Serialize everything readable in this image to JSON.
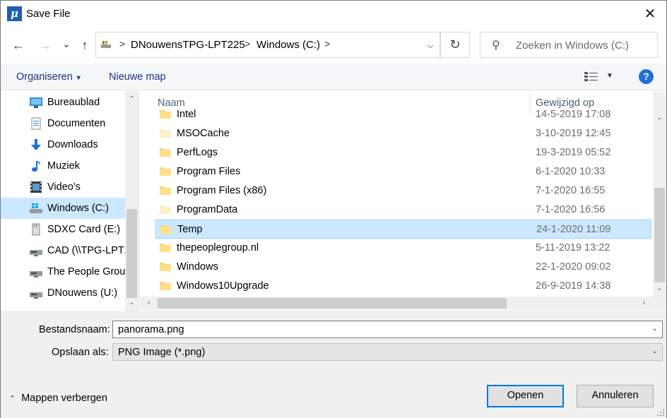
{
  "window": {
    "title": "Save File",
    "app_icon_glyph": "μ",
    "close_glyph": "✕"
  },
  "nav": {
    "back_glyph": "←",
    "forward_glyph": "→",
    "recent_glyph": "⌄",
    "up_glyph": "↑",
    "breadcrumbs": [
      "DNouwensTPG-LPT225",
      "Windows (C:)"
    ],
    "crumb_separator": ">",
    "refresh_glyph": "↻",
    "search_placeholder": "Zoeken in Windows (C:)"
  },
  "toolbar": {
    "organize_label": "Organiseren",
    "new_folder_label": "Nieuwe map",
    "help_glyph": "?"
  },
  "sidebar": {
    "items": [
      {
        "label": "Bureaublad",
        "icon": "desktop-icon",
        "selected": false
      },
      {
        "label": "Documenten",
        "icon": "documents-icon",
        "selected": false
      },
      {
        "label": "Downloads",
        "icon": "downloads-icon",
        "selected": false
      },
      {
        "label": "Muziek",
        "icon": "music-icon",
        "selected": false
      },
      {
        "label": "Video's",
        "icon": "videos-icon",
        "selected": false
      },
      {
        "label": "Windows (C:)",
        "icon": "windows-drive-icon",
        "selected": true
      },
      {
        "label": "SDXC Card (E:)",
        "icon": "sd-card-icon",
        "selected": false
      },
      {
        "label": "CAD (\\\\TPG-LPT2",
        "icon": "network-drive-icon",
        "selected": false
      },
      {
        "label": "The People Grou",
        "icon": "network-drive-icon",
        "selected": false
      },
      {
        "label": "DNouwens (U:)",
        "icon": "network-drive-icon",
        "selected": false
      }
    ]
  },
  "filelist": {
    "columns": {
      "name": "Naam",
      "modified": "Gewijzigd op"
    },
    "rows": [
      {
        "name": "Intel",
        "date": "14-5-2019 17:08",
        "selected": false,
        "faded": false
      },
      {
        "name": "MSOCache",
        "date": "3-10-2019 12:45",
        "selected": false,
        "faded": true
      },
      {
        "name": "PerfLogs",
        "date": "19-3-2019 05:52",
        "selected": false,
        "faded": false
      },
      {
        "name": "Program Files",
        "date": "6-1-2020 10:33",
        "selected": false,
        "faded": false
      },
      {
        "name": "Program Files (x86)",
        "date": "7-1-2020 16:55",
        "selected": false,
        "faded": false
      },
      {
        "name": "ProgramData",
        "date": "7-1-2020 16:56",
        "selected": false,
        "faded": true
      },
      {
        "name": "Temp",
        "date": "24-1-2020 11:09",
        "selected": true,
        "faded": false
      },
      {
        "name": "thepeoplegroup.nl",
        "date": "5-11-2019 13:22",
        "selected": false,
        "faded": false
      },
      {
        "name": "Windows",
        "date": "22-1-2020 09:02",
        "selected": false,
        "faded": false
      },
      {
        "name": "Windows10Upgrade",
        "date": "26-9-2019 14:38",
        "selected": false,
        "faded": false
      }
    ]
  },
  "form": {
    "filename_label": "Bestandsnaam:",
    "filename_value": "panorama.png",
    "filetype_label": "Opslaan als:",
    "filetype_value": "PNG Image (*.png)"
  },
  "footer": {
    "hide_folders_label": "Mappen verbergen",
    "open_label": "Openen",
    "cancel_label": "Annuleren"
  },
  "colors": {
    "selection": "#cce8ff",
    "selection_border": "#99d1ff",
    "accent": "#0078d7",
    "folder": "#f8d775"
  }
}
